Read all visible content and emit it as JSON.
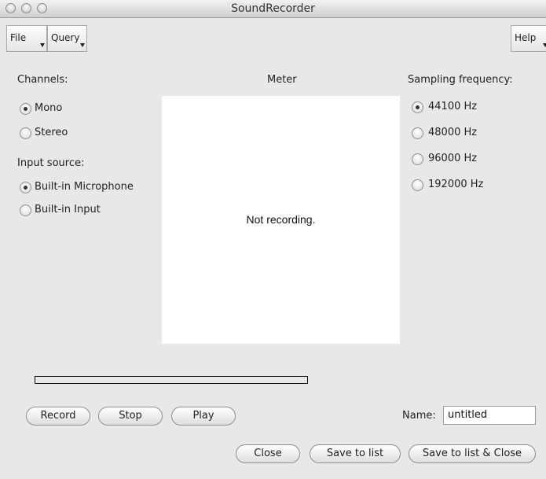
{
  "window": {
    "title": "SoundRecorder"
  },
  "menus": {
    "file": "File",
    "query": "Query",
    "help": "Help"
  },
  "channels": {
    "label": "Channels:",
    "options": [
      {
        "label": "Mono",
        "selected": true
      },
      {
        "label": "Stereo",
        "selected": false
      }
    ]
  },
  "input_source": {
    "label": "Input source:",
    "options": [
      {
        "label": "Built-in Microphone",
        "selected": true
      },
      {
        "label": "Built-in Input",
        "selected": false
      }
    ]
  },
  "meter": {
    "label": "Meter",
    "status": "Not recording."
  },
  "sampling": {
    "label": "Sampling frequency:",
    "options": [
      {
        "label": "44100 Hz",
        "selected": true
      },
      {
        "label": "48000 Hz",
        "selected": false
      },
      {
        "label": "96000 Hz",
        "selected": false
      },
      {
        "label": "192000 Hz",
        "selected": false
      }
    ]
  },
  "progress": {
    "value": 0
  },
  "controls": {
    "record": "Record",
    "stop": "Stop",
    "play": "Play"
  },
  "name": {
    "label": "Name:",
    "value": "untitled"
  },
  "footer": {
    "close": "Close",
    "save_to_list": "Save to list",
    "save_and_close": "Save to list & Close"
  }
}
